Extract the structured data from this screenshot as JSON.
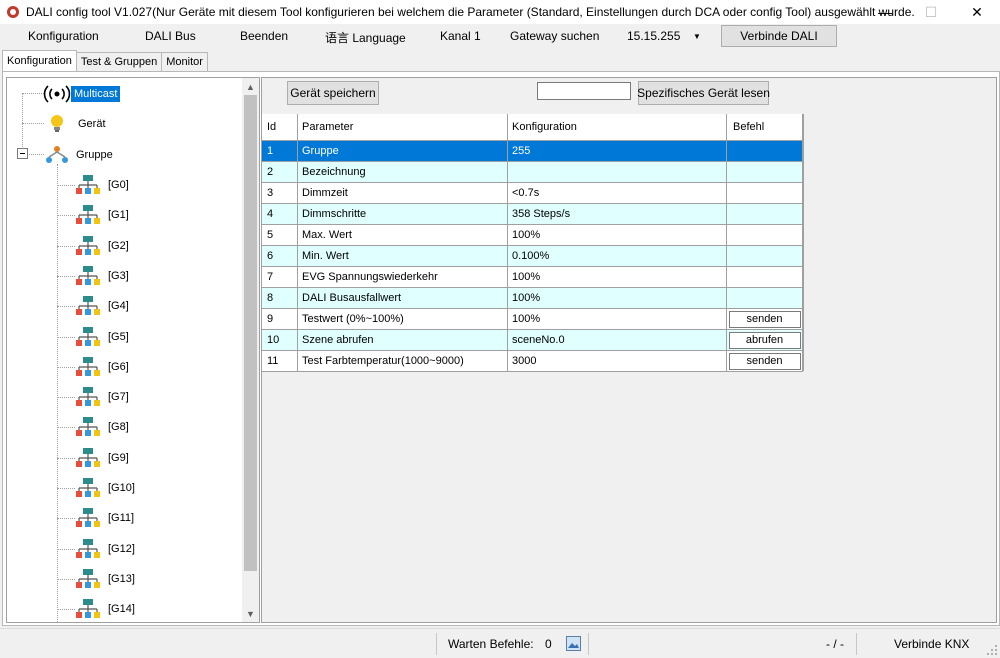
{
  "window": {
    "title": "DALI config tool V1.027(Nur Geräte mit diesem Tool konfigurieren bei welchem die Parameter (Standard, Einstellungen durch DCA oder config Tool) ausgewählt wurde.",
    "minimize": "—",
    "maximize": "☐",
    "close": "✕"
  },
  "menu": {
    "konfiguration": "Konfiguration",
    "dali_bus": "DALI Bus",
    "beenden": "Beenden",
    "language": "语言 Language",
    "kanal": "Kanal 1",
    "gateway": "Gateway suchen",
    "address_value": "15.15.255",
    "connect_dali": "Verbinde DALI"
  },
  "tabs": [
    "Konfiguration",
    "Test & Gruppen",
    "Monitor"
  ],
  "tree": {
    "multicast": "Multicast",
    "device": "Gerät",
    "group": "Gruppe",
    "groups": [
      "[G0]",
      "[G1]",
      "[G2]",
      "[G3]",
      "[G4]",
      "[G5]",
      "[G6]",
      "[G7]",
      "[G8]",
      "[G9]",
      "[G10]",
      "[G11]",
      "[G12]",
      "[G13]",
      "[G14]"
    ]
  },
  "toolbar": {
    "save_device": "Gerät speichern",
    "id_input_value": "",
    "read_specific": "Spezifisches Gerät lesen"
  },
  "grid": {
    "headers": {
      "id": "Id",
      "param": "Parameter",
      "conf": "Konfiguration",
      "action": "Befehl"
    },
    "rows": [
      {
        "id": "1",
        "param": "Gruppe",
        "conf": "255",
        "action": ""
      },
      {
        "id": "2",
        "param": "Bezeichnung",
        "conf": "",
        "action": ""
      },
      {
        "id": "3",
        "param": "Dimmzeit",
        "conf": "<0.7s",
        "action": ""
      },
      {
        "id": "4",
        "param": "Dimmschritte",
        "conf": "358 Steps/s",
        "action": ""
      },
      {
        "id": "5",
        "param": "Max. Wert",
        "conf": "100%",
        "action": ""
      },
      {
        "id": "6",
        "param": "Min. Wert",
        "conf": "0.100%",
        "action": ""
      },
      {
        "id": "7",
        "param": "EVG Spannungswiederkehr",
        "conf": "100%",
        "action": ""
      },
      {
        "id": "8",
        "param": "DALI Busausfallwert",
        "conf": "100%",
        "action": ""
      },
      {
        "id": "9",
        "param": "Testwert (0%~100%)",
        "conf": "100%",
        "action": "senden"
      },
      {
        "id": "10",
        "param": "Szene abrufen",
        "conf": "sceneNo.0",
        "action": "abrufen"
      },
      {
        "id": "11",
        "param": "Test Farbtemperatur(1000~9000)",
        "conf": "3000",
        "action": "senden"
      }
    ]
  },
  "status": {
    "waiting_label": "Warten Befehle:",
    "waiting_count": "0",
    "dash": "- / -",
    "connect_knx": "Verbinde KNX"
  },
  "colors": {
    "selection": "#0078d7",
    "alt_row": "#e0ffff",
    "multicast_selected": "#0078d7"
  }
}
